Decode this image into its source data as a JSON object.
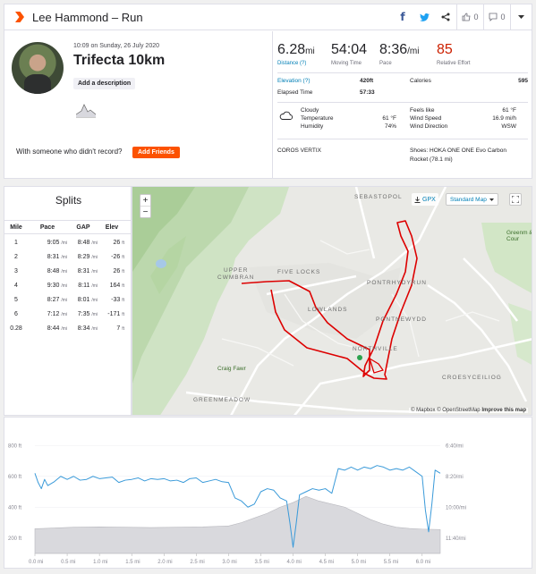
{
  "header": {
    "title": "Lee Hammond – Run",
    "kudos_count": "0",
    "comment_count": "0"
  },
  "activity": {
    "date": "10:09 on Sunday, 26 July 2020",
    "name": "Trifecta 10km",
    "add_description": "Add a description",
    "invite_text": "With someone who didn't record?",
    "add_friends": "Add Friends"
  },
  "stats": {
    "distance": {
      "value": "6.28",
      "unit": "mi",
      "label": "Distance (?)"
    },
    "moving_time": {
      "value": "54:04",
      "label": "Moving Time"
    },
    "pace": {
      "value": "8:36",
      "unit": "/mi",
      "label": "Pace"
    },
    "effort": {
      "value": "85",
      "label": "Relative Effort"
    }
  },
  "details": {
    "elevation_label": "Elevation (?)",
    "elevation_value": "420ft",
    "calories_label": "Calories",
    "calories_value": "595",
    "elapsed_label": "Elapsed Time",
    "elapsed_value": "57:33",
    "weather": "Cloudy",
    "temperature_label": "Temperature",
    "temperature_value": "61 °F",
    "humidity_label": "Humidity",
    "humidity_value": "74%",
    "feels_label": "Feels like",
    "feels_value": "61 °F",
    "wind_speed_label": "Wind Speed",
    "wind_speed_value": "16.9 mi/h",
    "wind_dir_label": "Wind Direction",
    "wind_dir_value": "WSW",
    "device": "COROS VERTIX",
    "shoes_line1": "Shoes: HOKA ONE ONE Evo Carbon",
    "shoes_line2": "Rocket (78.1 mi)"
  },
  "splits": {
    "title": "Splits",
    "headers": [
      "Mile",
      "Pace",
      "GAP",
      "Elev"
    ],
    "pace_unit": "/mi",
    "elev_unit": "ft",
    "rows": [
      {
        "mile": "1",
        "pace": "9:05",
        "gap": "8:48",
        "elev": "26"
      },
      {
        "mile": "2",
        "pace": "8:31",
        "gap": "8:29",
        "elev": "-26"
      },
      {
        "mile": "3",
        "pace": "8:48",
        "gap": "8:31",
        "elev": "26"
      },
      {
        "mile": "4",
        "pace": "9:30",
        "gap": "8:11",
        "elev": "164"
      },
      {
        "mile": "5",
        "pace": "8:27",
        "gap": "8:01",
        "elev": "-33"
      },
      {
        "mile": "6",
        "pace": "7:12",
        "gap": "7:35",
        "elev": "-171"
      },
      {
        "mile": "0.28",
        "pace": "8:44",
        "gap": "8:34",
        "elev": "7"
      }
    ]
  },
  "map": {
    "gpx": "GPX",
    "style": "Standard Map",
    "attribution_mapbox": "© Mapbox",
    "attribution_osm": "© OpenStreetMap",
    "improve": "Improve this map",
    "places": [
      "SEBASTOPOL",
      "UPPER",
      "CWMBRAN",
      "FIVE LOCKS",
      "PONTRHYDYRUN",
      "LOWLANDS",
      "PONTNEWYDD",
      "NORTHVILLE",
      "Craig Fawr",
      "GREENMEADOW",
      "CROESYCEILIOG",
      "Greenm & Cour"
    ],
    "zoom_in": "+",
    "zoom_out": "−"
  },
  "chart_data": {
    "type": "area",
    "x_ticks": [
      "0.0 mi",
      "0.5 mi",
      "1.0 mi",
      "1.5 mi",
      "2.0 mi",
      "2.5 mi",
      "3.0 mi",
      "3.5 mi",
      "4.0 mi",
      "4.5 mi",
      "5.0 mi",
      "5.5 mi",
      "6.0 mi"
    ],
    "y_left_ticks": [
      "800 ft",
      "600 ft",
      "400 ft",
      "200 ft"
    ],
    "y_right_ticks": [
      "6:40/mi",
      "8:20/mi",
      "10:00/mi",
      "11:40/mi"
    ],
    "xlim": [
      0,
      6.28
    ],
    "elevation": {
      "x": [
        0,
        0.3,
        0.6,
        1.0,
        1.4,
        1.8,
        2.2,
        2.6,
        3.0,
        3.2,
        3.4,
        3.6,
        3.8,
        4.0,
        4.2,
        4.4,
        4.6,
        4.8,
        5.0,
        5.2,
        5.4,
        5.6,
        5.8,
        6.0,
        6.28
      ],
      "y": [
        260,
        265,
        270,
        272,
        270,
        268,
        270,
        272,
        278,
        300,
        330,
        360,
        400,
        430,
        470,
        440,
        420,
        400,
        360,
        320,
        290,
        270,
        262,
        258,
        255
      ]
    },
    "pace": {
      "x": [
        0.0,
        0.05,
        0.1,
        0.15,
        0.2,
        0.3,
        0.4,
        0.5,
        0.6,
        0.7,
        0.8,
        0.9,
        1.0,
        1.1,
        1.2,
        1.3,
        1.4,
        1.5,
        1.6,
        1.7,
        1.8,
        1.9,
        2.0,
        2.1,
        2.2,
        2.3,
        2.4,
        2.5,
        2.6,
        2.7,
        2.8,
        2.9,
        3.0,
        3.1,
        3.2,
        3.3,
        3.4,
        3.5,
        3.6,
        3.7,
        3.8,
        3.9,
        3.95,
        4.0,
        4.05,
        4.1,
        4.2,
        4.3,
        4.4,
        4.5,
        4.6,
        4.7,
        4.8,
        4.9,
        5.0,
        5.1,
        5.2,
        5.3,
        5.4,
        5.5,
        5.6,
        5.7,
        5.8,
        5.9,
        6.0,
        6.05,
        6.1,
        6.15,
        6.2,
        6.28
      ],
      "y": [
        620,
        560,
        520,
        580,
        540,
        565,
        600,
        580,
        600,
        575,
        580,
        600,
        585,
        590,
        595,
        560,
        575,
        580,
        590,
        570,
        585,
        580,
        585,
        570,
        575,
        560,
        585,
        590,
        560,
        570,
        580,
        565,
        560,
        460,
        440,
        400,
        420,
        500,
        520,
        510,
        460,
        440,
        300,
        140,
        300,
        480,
        500,
        520,
        510,
        520,
        490,
        650,
        640,
        660,
        640,
        660,
        650,
        670,
        660,
        640,
        650,
        640,
        660,
        630,
        600,
        380,
        240,
        420,
        640,
        620
      ]
    }
  }
}
